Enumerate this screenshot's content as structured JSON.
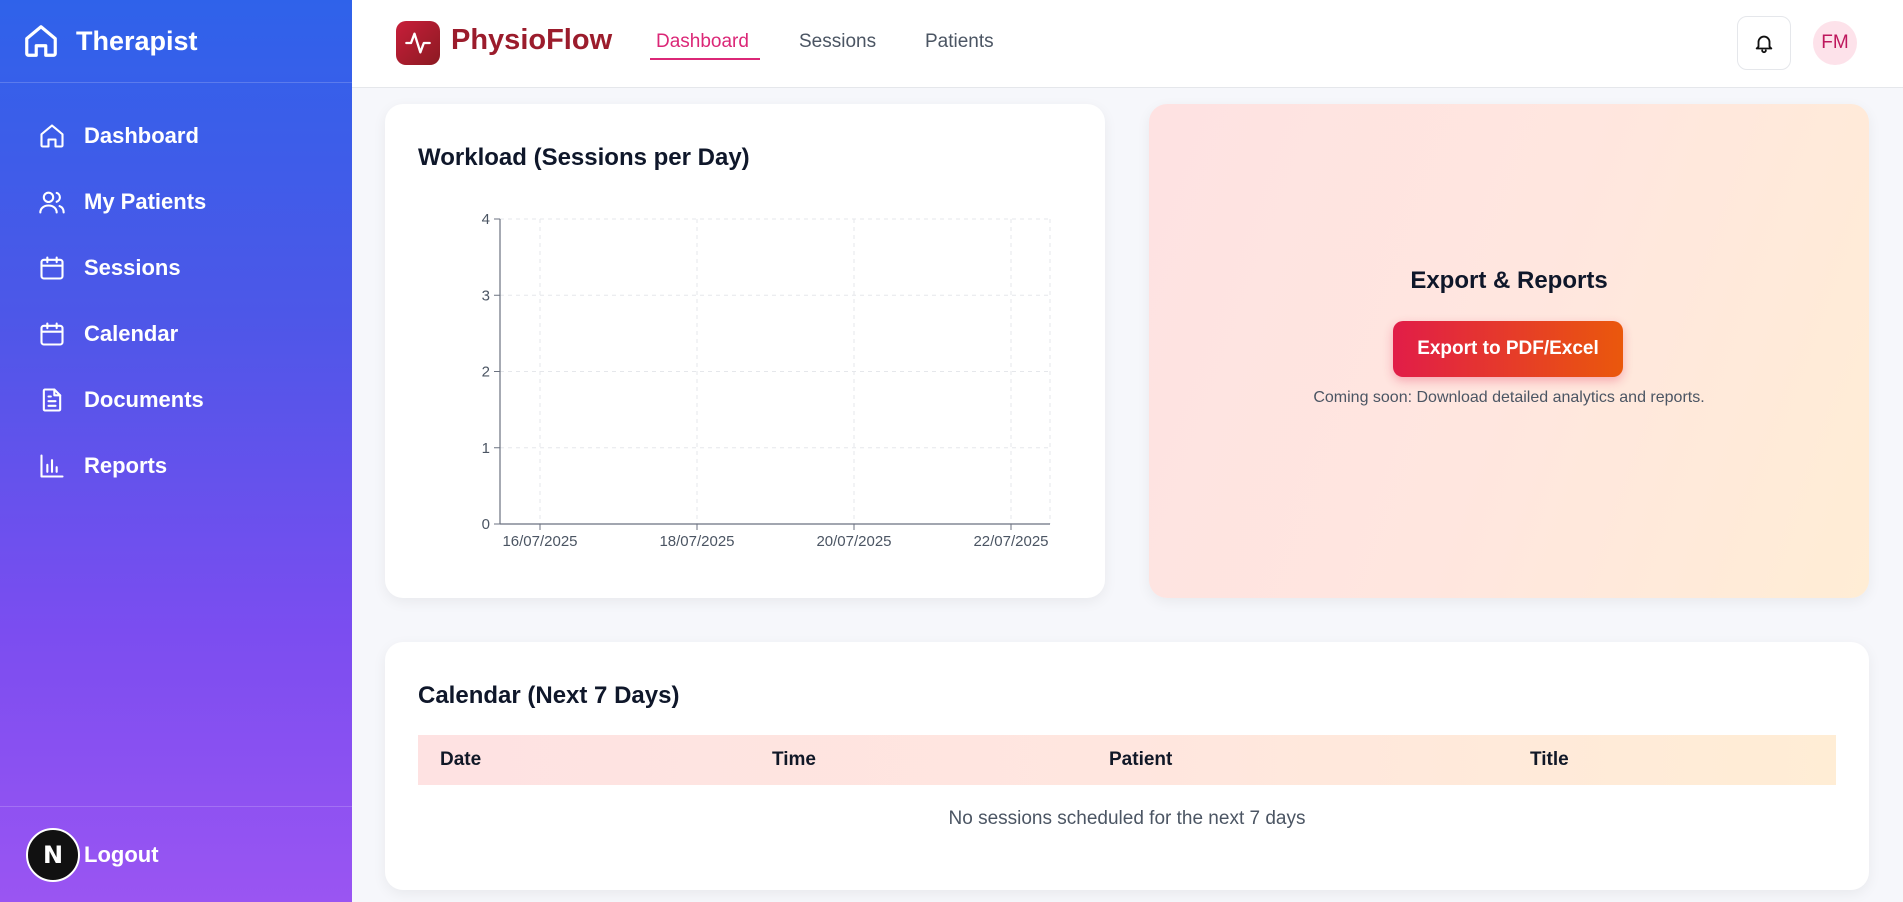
{
  "sidebar": {
    "brand": "Therapist",
    "items": [
      {
        "label": "Dashboard",
        "icon": "home-icon"
      },
      {
        "label": "My Patients",
        "icon": "users-icon"
      },
      {
        "label": "Sessions",
        "icon": "calendar-icon"
      },
      {
        "label": "Calendar",
        "icon": "calendar-icon"
      },
      {
        "label": "Documents",
        "icon": "document-icon"
      },
      {
        "label": "Reports",
        "icon": "bar-chart-icon"
      }
    ],
    "logout": {
      "avatar_letter": "N",
      "label": "Logout"
    }
  },
  "topbar": {
    "logo_text": "PhysioFlow",
    "tabs": [
      {
        "label": "Dashboard",
        "active": true
      },
      {
        "label": "Sessions",
        "active": false
      },
      {
        "label": "Patients",
        "active": false
      }
    ],
    "user_initials": "FM"
  },
  "workload": {
    "title": "Workload (Sessions per Day)"
  },
  "chart_data": {
    "type": "line",
    "title": "Workload (Sessions per Day)",
    "x_tick_labels": [
      "16/07/2025",
      "18/07/2025",
      "20/07/2025",
      "22/07/2025"
    ],
    "y_ticks": [
      0,
      1,
      2,
      3,
      4
    ],
    "ylim": [
      0,
      4
    ],
    "series": [],
    "grid": true
  },
  "export": {
    "title": "Export & Reports",
    "button_label": "Export to PDF/Excel",
    "note": "Coming soon: Download detailed analytics and reports."
  },
  "calendar": {
    "title": "Calendar (Next 7 Days)",
    "columns": [
      "Date",
      "Time",
      "Patient",
      "Title"
    ],
    "rows": [],
    "empty_message": "No sessions scheduled for the next 7 days"
  },
  "colors": {
    "sidebar_top": "#2f62ea",
    "sidebar_bottom": "#9a55f2",
    "accent": "#db2777",
    "brand": "#9b1c2c"
  }
}
